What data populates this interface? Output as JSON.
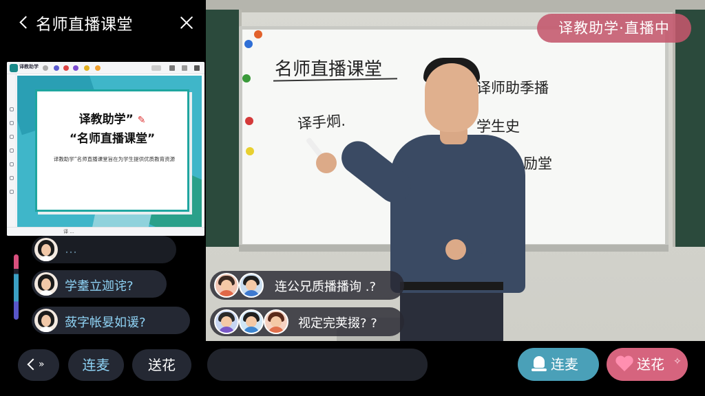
{
  "header": {
    "title": "名师直播课堂"
  },
  "slide": {
    "brand": "译教助学",
    "line1": "译教助学”",
    "line2": "“名师直播课堂”",
    "line3": "译教助学”名师直播课堂旨在为学生提供优质教育资源",
    "bottom_text": "译 ..."
  },
  "left_chat": [
    {
      "text": "…",
      "faded": true
    },
    {
      "text": "学耋立迦诧?"
    },
    {
      "text": "蔹字帐妟如谖?"
    }
  ],
  "video": {
    "live_badge": "译教助学·直播中",
    "whiteboard": {
      "title": "名师直播课堂",
      "left_note": "译手炯.",
      "right_notes": [
        "译师助季播",
        "学生史",
        "乂励堂"
      ]
    },
    "chat": [
      {
        "text": "连公兄质播播询 .?"
      },
      {
        "text": "视定完荚掇?  ?"
      }
    ]
  },
  "bottom": {
    "collapse_arrows": "»",
    "lianmai_left": "连麦",
    "songhua_left": "送花",
    "lianmai": "连麦",
    "songhua": "送花",
    "sparkle": "✧"
  },
  "colors": {
    "live_badge": "#c4566c",
    "lianmai_button": "#4aa0b8",
    "songhua_button": "#d6647e",
    "chat_text": "#8fd3f5"
  }
}
